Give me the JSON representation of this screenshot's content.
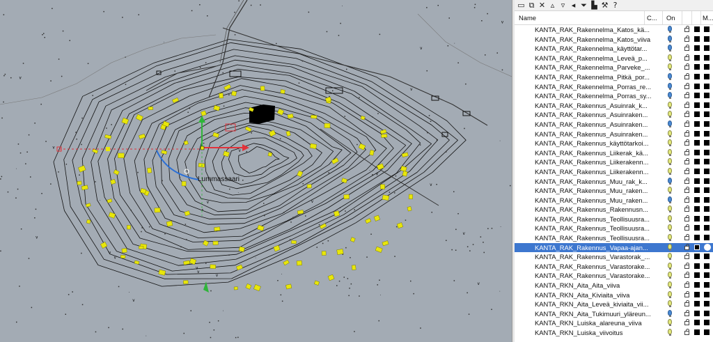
{
  "viewport": {
    "map_label": "Lummassaari",
    "bg_color": "#a3abb4",
    "building_color": "#e8e60a",
    "contour_color": "#111111"
  },
  "panel": {
    "toolbar_icons": [
      "new-layer-icon",
      "new-sublayer-icon",
      "delete-icon",
      "move-up-icon",
      "move-down-icon",
      "move-to-parent-icon",
      "filter-icon",
      "layer-tools-icon",
      "tools-icon",
      "help-icon"
    ],
    "columns": {
      "name": "Name",
      "current": "C...",
      "on": "On",
      "material": "M..."
    },
    "selection_color": "#3d77cf",
    "layers": [
      {
        "name": "KANTA_RAK_Rakennelma_Katos_kä...",
        "bulb": "on"
      },
      {
        "name": "KANTA_RAK_Rakennelma_Katos_viiva",
        "bulb": "on"
      },
      {
        "name": "KANTA_RAK_Rakennelma_käyttötar...",
        "bulb": "on"
      },
      {
        "name": "KANTA_RAK_Rakennelma_Leveä_p...",
        "bulb": "off"
      },
      {
        "name": "KANTA_RAK_Rakennelma_Parveke_...",
        "bulb": "off"
      },
      {
        "name": "KANTA_RAK_Rakennelma_Pitkä_por...",
        "bulb": "on"
      },
      {
        "name": "KANTA_RAK_Rakennelma_Porras_re...",
        "bulb": "on"
      },
      {
        "name": "KANTA_RAK_Rakennelma_Porras_sy...",
        "bulb": "on"
      },
      {
        "name": "KANTA_RAK_Rakennus_Asuinrak_k...",
        "bulb": "off"
      },
      {
        "name": "KANTA_RAK_Rakennus_Asuinraken...",
        "bulb": "off"
      },
      {
        "name": "KANTA_RAK_Rakennus_Asuinraken...",
        "bulb": "on"
      },
      {
        "name": "KANTA_RAK_Rakennus_Asuinraken...",
        "bulb": "off"
      },
      {
        "name": "KANTA_RAK_Rakennus_käyttötarkoi...",
        "bulb": "off"
      },
      {
        "name": "KANTA_RAK_Rakennus_Liikerak_kä...",
        "bulb": "off"
      },
      {
        "name": "KANTA_RAK_Rakennus_Liikerakenn...",
        "bulb": "off"
      },
      {
        "name": "KANTA_RAK_Rakennus_Liikerakenn...",
        "bulb": "off"
      },
      {
        "name": "KANTA_RAK_Rakennus_Muu_rak_k...",
        "bulb": "on"
      },
      {
        "name": "KANTA_RAK_Rakennus_Muu_raken...",
        "bulb": "off"
      },
      {
        "name": "KANTA_RAK_Rakennus_Muu_raken...",
        "bulb": "on"
      },
      {
        "name": "KANTA_RAK_Rakennus_Rakennusn...",
        "bulb": "off"
      },
      {
        "name": "KANTA_RAK_Rakennus_Teollisuusra...",
        "bulb": "off"
      },
      {
        "name": "KANTA_RAK_Rakennus_Teollisuusra...",
        "bulb": "off"
      },
      {
        "name": "KANTA_RAK_Rakennus_Teollisuusra...",
        "bulb": "off"
      },
      {
        "name": "KANTA_RAK_Rakennus_Vapaa-ajan...",
        "bulb": "off",
        "selected": true
      },
      {
        "name": "KANTA_RAK_Rakennus_Varastorak_...",
        "bulb": "off"
      },
      {
        "name": "KANTA_RAK_Rakennus_Varastorake...",
        "bulb": "off"
      },
      {
        "name": "KANTA_RAK_Rakennus_Varastorake...",
        "bulb": "off"
      },
      {
        "name": "KANTA_RKN_Aita_Aita_viiva",
        "bulb": "off"
      },
      {
        "name": "KANTA_RKN_Aita_Kiviaita_viiva",
        "bulb": "off"
      },
      {
        "name": "KANTA_RKN_Aita_Leveä_kiviaita_vii...",
        "bulb": "off"
      },
      {
        "name": "KANTA_RKN_Aita_Tukimuuri_yläreun...",
        "bulb": "on"
      },
      {
        "name": "KANTA_RKN_Luiska_alareuna_viiva",
        "bulb": "off"
      },
      {
        "name": "KANTA_RKN_Luiska_viivoitus",
        "bulb": "off"
      }
    ]
  }
}
